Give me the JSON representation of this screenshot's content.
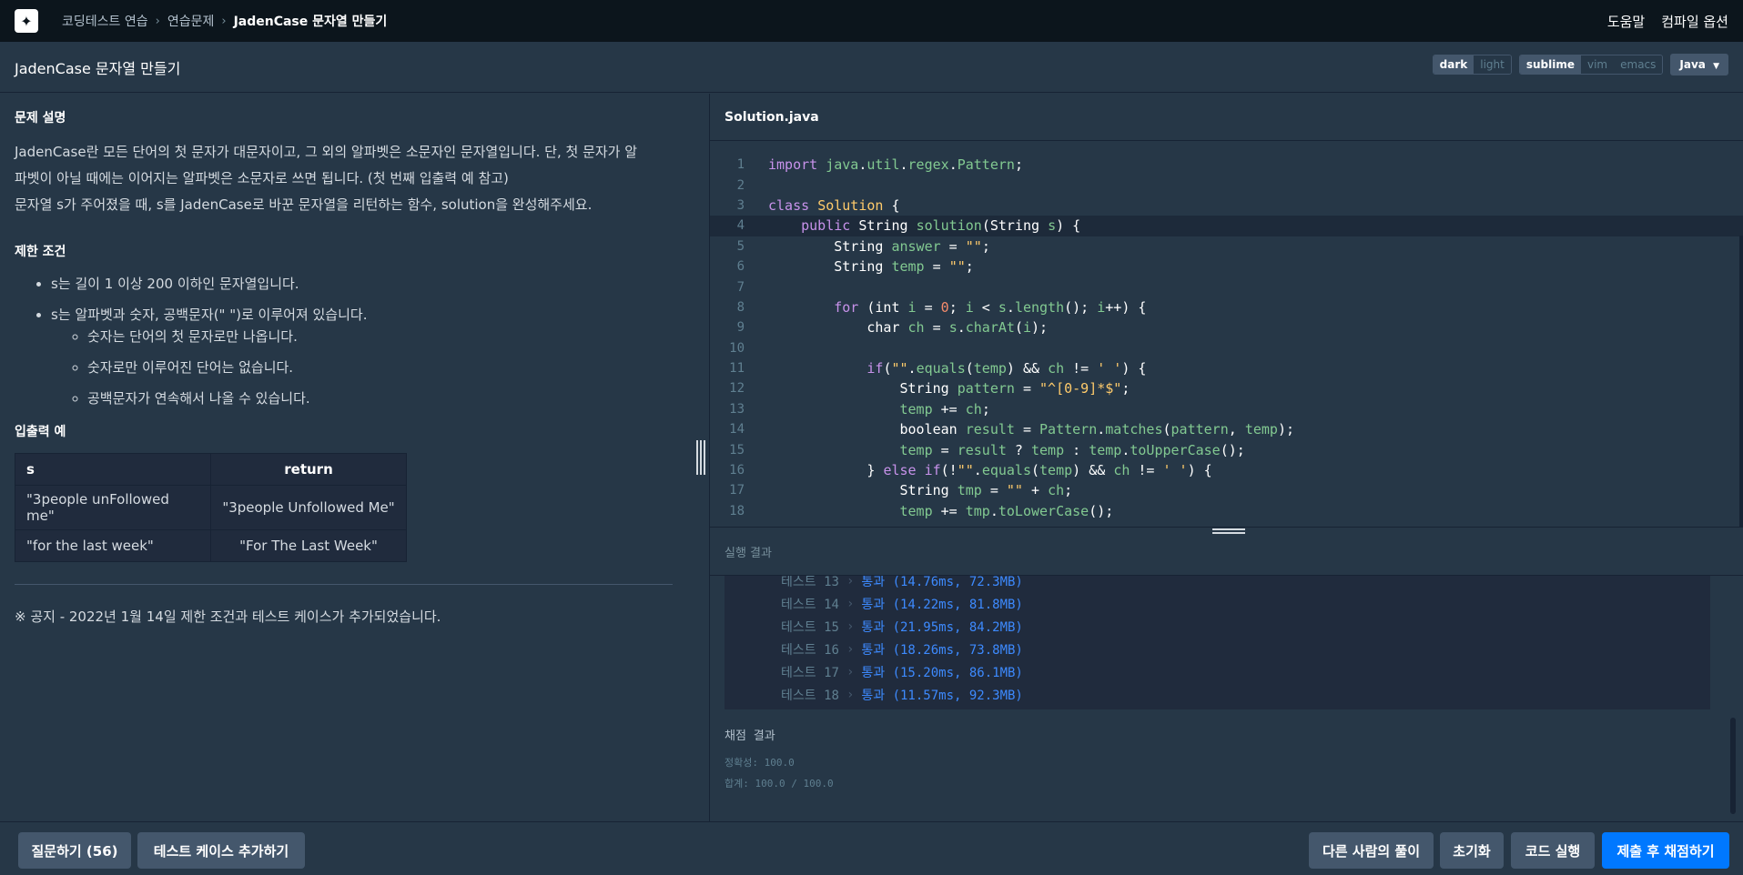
{
  "topbar": {
    "logo_icon": "programmers-logo-icon",
    "breadcrumb": [
      "코딩테스트 연습",
      "연습문제",
      "JadenCase 문자열 만들기"
    ],
    "help": "도움말",
    "compile_options": "컴파일 옵션"
  },
  "header": {
    "title": "JadenCase 문자열 만들기",
    "theme": {
      "dark": "dark",
      "light": "light",
      "selected": "dark"
    },
    "keymap": {
      "sublime": "sublime",
      "vim": "vim",
      "emacs": "emacs",
      "selected": "sublime"
    },
    "language": "Java"
  },
  "problem": {
    "desc_title": "문제 설명",
    "desc_lines": [
      "JadenCase란 모든 단어의 첫 문자가 대문자이고, 그 외의 알파벳은 소문자인 문자열입니다. 단, 첫 문자가 알",
      "파벳이 아닐 때에는 이어지는 알파벳은 소문자로 쓰면 됩니다. (첫 번째 입출력 예 참고)",
      "문자열 s가 주어졌을 때, s를 JadenCase로 바꾼 문자열을 리턴하는 함수, solution을 완성해주세요."
    ],
    "constraints_title": "제한 조건",
    "constraints": [
      "s는 길이 1 이상 200 이하인 문자열입니다.",
      "s는 알파벳과 숫자, 공백문자(\" \")로 이루어져 있습니다."
    ],
    "sub_constraints": [
      "숫자는 단어의 첫 문자로만 나옵니다.",
      "숫자로만 이루어진 단어는 없습니다.",
      "공백문자가 연속해서 나올 수 있습니다."
    ],
    "examples_title": "입출력 예",
    "examples_headers": [
      "s",
      "return"
    ],
    "examples": [
      [
        "\"3people unFollowed me\"",
        "\"3people Unfollowed Me\""
      ],
      [
        "\"for the last week\"",
        "\"For The Last Week\""
      ]
    ],
    "notice": "※ 공지 - 2022년 1월 14일 제한 조건과 테스트 케이스가 추가되었습니다."
  },
  "editor": {
    "filename": "Solution.java",
    "line_numbers": [
      "1",
      "2",
      "3",
      "4",
      "5",
      "6",
      "7",
      "8",
      "9",
      "10",
      "11",
      "12",
      "13",
      "14",
      "15",
      "16",
      "17",
      "18"
    ]
  },
  "results": {
    "title": "실행 결과",
    "tests": [
      {
        "name": "테스트 13",
        "result": "통과 (14.76ms, 72.3MB)"
      },
      {
        "name": "테스트 14",
        "result": "통과 (14.22ms, 81.8MB)"
      },
      {
        "name": "테스트 15",
        "result": "통과 (21.95ms, 84.2MB)"
      },
      {
        "name": "테스트 16",
        "result": "통과 (18.26ms, 73.8MB)"
      },
      {
        "name": "테스트 17",
        "result": "통과 (15.20ms, 86.1MB)"
      },
      {
        "name": "테스트 18",
        "result": "통과 (11.57ms, 92.3MB)"
      }
    ],
    "score_title": "채점 결과",
    "accuracy_label": "정확성:",
    "accuracy_value": "100.0",
    "total_label": "합계:",
    "total_value": "100.0 / 100.0"
  },
  "footer": {
    "ask": "질문하기 (56)",
    "add_testcase": "테스트 케이스 추가하기",
    "others": "다른 사람의 풀이",
    "reset": "초기화",
    "run": "코드 실행",
    "submit": "제출 후 채점하기"
  }
}
